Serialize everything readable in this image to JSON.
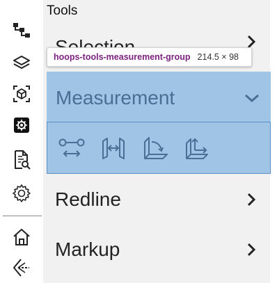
{
  "panel": {
    "title": "Tools",
    "sections": {
      "selection": "Selection",
      "measurement": "Measurement",
      "redline": "Redline",
      "markup": "Markup"
    },
    "measurement_expanded": true,
    "measurement_tools": [
      {
        "icon": "measure-point-to-point-icon"
      },
      {
        "icon": "measure-edge-icon"
      },
      {
        "icon": "measure-angle-icon"
      },
      {
        "icon": "measure-face-distance-icon"
      }
    ]
  },
  "toolbar": {
    "icons": [
      "model-tree-icon",
      "layers-icon",
      "views-icon",
      "settings-cube-icon",
      "search-document-icon",
      "gear-icon",
      "home-icon",
      "camera-icon"
    ]
  },
  "tooltip": {
    "element_name": "hoops-tools-measurement-group",
    "dimensions": "214.5 × 98"
  },
  "colors": {
    "highlight": "#9fc4e6",
    "highlight_border": "#5d8fc4",
    "measurement_text": "#4a6e94",
    "tooltip_name": "#7a1f7e",
    "panel_bg": "#f1f1f1"
  }
}
